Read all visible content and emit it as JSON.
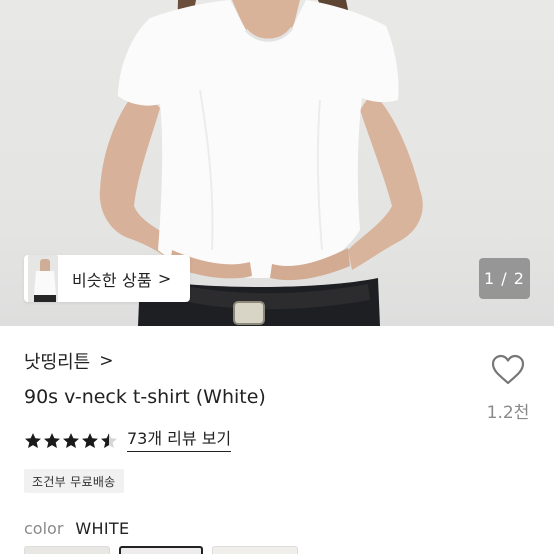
{
  "gallery": {
    "similar_label": "비슷한 상품",
    "similar_chevron": ">",
    "pager": "1 / 2"
  },
  "product": {
    "shop_name": "낫띵리튼",
    "shop_chevron": ">",
    "title": "90s v-neck t-shirt (White)",
    "like_count": "1.2천",
    "rating": 4.5,
    "review_link": "73개 리뷰 보기",
    "shipping_badge": "조건부 무료배송",
    "color_label": "color",
    "color_value": "WHITE",
    "selected_swatch": 2
  },
  "icons": {
    "heart": "heart-outline-icon",
    "star": "star-icon",
    "chevron": "chevron-right-icon"
  },
  "colors": {
    "text": "#222222",
    "muted": "#8a8a8a",
    "badge_bg": "#f1f1f1",
    "pager_bg": "#787878",
    "image_bg": "#e6e6e4"
  }
}
